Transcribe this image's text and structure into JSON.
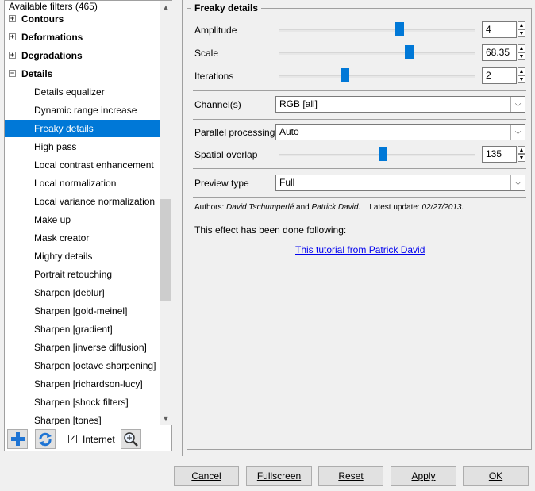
{
  "tree": {
    "title": "Available filters (465)",
    "items": [
      {
        "type": "category",
        "label": "Contours",
        "expander": "+"
      },
      {
        "type": "category",
        "label": "Deformations",
        "expander": "+"
      },
      {
        "type": "category",
        "label": "Degradations",
        "expander": "+"
      },
      {
        "type": "category",
        "label": "Details",
        "expander": "−"
      },
      {
        "type": "leaf",
        "label": "Details equalizer"
      },
      {
        "type": "leaf",
        "label": "Dynamic range increase"
      },
      {
        "type": "leaf",
        "label": "Freaky details",
        "selected": true
      },
      {
        "type": "leaf",
        "label": "High pass"
      },
      {
        "type": "leaf",
        "label": "Local contrast enhancement"
      },
      {
        "type": "leaf",
        "label": "Local normalization"
      },
      {
        "type": "leaf",
        "label": "Local variance normalization"
      },
      {
        "type": "leaf",
        "label": "Make up"
      },
      {
        "type": "leaf",
        "label": "Mask creator"
      },
      {
        "type": "leaf",
        "label": "Mighty details"
      },
      {
        "type": "leaf",
        "label": "Portrait retouching"
      },
      {
        "type": "leaf",
        "label": "Sharpen [deblur]"
      },
      {
        "type": "leaf",
        "label": "Sharpen [gold-meinel]"
      },
      {
        "type": "leaf",
        "label": "Sharpen [gradient]"
      },
      {
        "type": "leaf",
        "label": "Sharpen [inverse diffusion]"
      },
      {
        "type": "leaf",
        "label": "Sharpen [octave sharpening]"
      },
      {
        "type": "leaf",
        "label": "Sharpen [richardson-lucy]"
      },
      {
        "type": "leaf",
        "label": "Sharpen [shock filters]"
      },
      {
        "type": "leaf",
        "label": "Sharpen [tones]"
      }
    ],
    "toolbar": {
      "internet_label": "Internet",
      "internet_checked": true,
      "add_icon": "plus-icon",
      "refresh_icon": "refresh-icon",
      "zoom_icon": "zoom-icon"
    }
  },
  "params": {
    "title": "Freaky details",
    "amplitude": {
      "label": "Amplitude",
      "value": "4",
      "level": 0.62
    },
    "scale": {
      "label": "Scale",
      "value": "68.35",
      "level": 0.67
    },
    "iterations": {
      "label": "Iterations",
      "value": "2",
      "level": 0.33
    },
    "channels": {
      "label": "Channel(s)",
      "value": "RGB [all]"
    },
    "parallel": {
      "label": "Parallel processing",
      "value": "Auto"
    },
    "overlap": {
      "label": "Spatial overlap",
      "value": "135",
      "level": 0.53
    },
    "preview": {
      "label": "Preview type",
      "value": "Full"
    },
    "authors_prefix": "Authors:",
    "author1": "David Tschumperlé",
    "and": "and",
    "author2": "Patrick David.",
    "update_prefix": "Latest update:",
    "update_date": "02/27/2013.",
    "notice": "This effect has been done following:",
    "link": "This tutorial from Patrick David"
  },
  "buttons": {
    "cancel": "Cancel",
    "fullscreen": "Fullscreen",
    "reset": "Reset",
    "apply": "Apply",
    "ok": "OK"
  },
  "colors": {
    "accent": "#0078d7",
    "link": "#0000ee"
  }
}
